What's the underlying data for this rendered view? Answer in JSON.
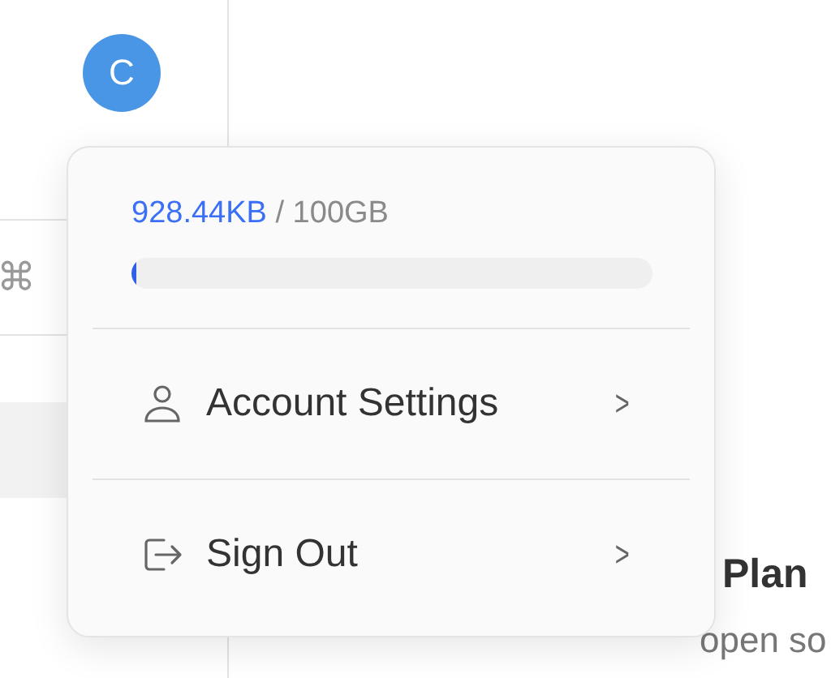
{
  "sidebar": {
    "avatar": "C",
    "shortcut": "⌘"
  },
  "main": {
    "heading": "Plan",
    "subtitle": "open so"
  },
  "menu": {
    "usage": {
      "used": "928.44KB",
      "total": " / 100GB",
      "level": 0.01
    },
    "items": [
      {
        "kind": "account",
        "label": "Account Settings",
        "chevron": ">"
      },
      {
        "kind": "signout",
        "label": "Sign Out",
        "chevron": ">"
      }
    ]
  }
}
